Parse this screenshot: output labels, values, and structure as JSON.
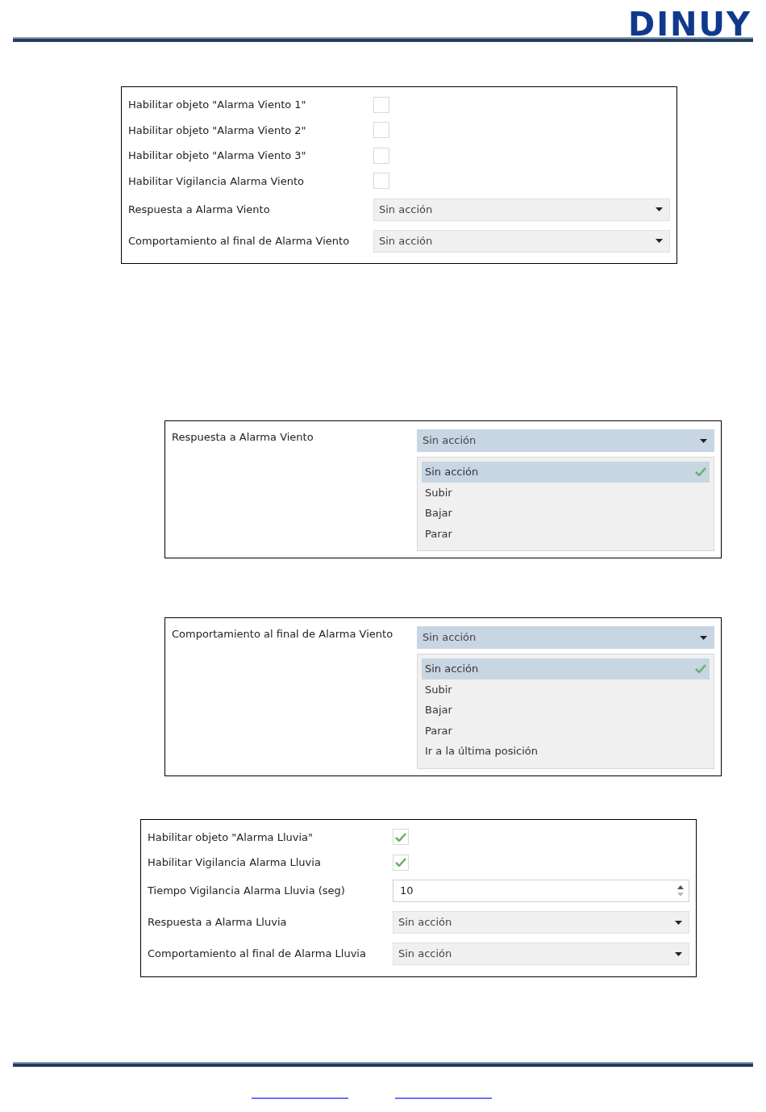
{
  "header": {
    "logo": "DINUY"
  },
  "panels": [
    {
      "kind": "form",
      "rows": [
        {
          "kind": "checkbox",
          "label": "Habilitar objeto \"Alarma Viento 1\"",
          "checked": false
        },
        {
          "kind": "checkbox",
          "label": "Habilitar objeto \"Alarma Viento 2\"",
          "checked": false
        },
        {
          "kind": "checkbox",
          "label": "Habilitar objeto \"Alarma Viento 3\"",
          "checked": false
        },
        {
          "kind": "checkbox",
          "label": "Habilitar Vigilancia Alarma Viento",
          "checked": false
        },
        {
          "kind": "select",
          "label": "Respuesta a Alarma Viento",
          "value": "Sin acción"
        },
        {
          "kind": "select",
          "label": "Comportamiento al final de Alarma Viento",
          "value": "Sin acción"
        }
      ]
    },
    {
      "kind": "dropdown",
      "rows": [
        {
          "kind": "select",
          "label": "Respuesta a Alarma Viento",
          "value": "Sin acción",
          "expanded": true,
          "options": [
            {
              "label": "Sin acción",
              "selected": true
            },
            {
              "label": "Subir",
              "selected": false
            },
            {
              "label": "Bajar",
              "selected": false
            },
            {
              "label": "Parar",
              "selected": false
            }
          ]
        }
      ]
    },
    {
      "kind": "dropdown",
      "rows": [
        {
          "kind": "select",
          "label": "Comportamiento al final de Alarma Viento",
          "value": "Sin acción",
          "expanded": true,
          "options": [
            {
              "label": "Sin acción",
              "selected": true
            },
            {
              "label": "Subir",
              "selected": false
            },
            {
              "label": "Bajar",
              "selected": false
            },
            {
              "label": "Parar",
              "selected": false
            },
            {
              "label": "Ir a la última posición",
              "selected": false
            }
          ]
        }
      ]
    },
    {
      "kind": "form",
      "rows": [
        {
          "kind": "checkbox",
          "label": "Habilitar objeto \"Alarma Lluvia\"",
          "checked": true
        },
        {
          "kind": "checkbox",
          "label": "Habilitar Vigilancia Alarma Lluvia",
          "checked": true
        },
        {
          "kind": "number",
          "label": "Tiempo Vigilancia Alarma Lluvia (seg)",
          "value": "10"
        },
        {
          "kind": "select",
          "label": "Respuesta a Alarma Lluvia",
          "value": "Sin acción"
        },
        {
          "kind": "select",
          "label": "Comportamiento al final de Alarma Lluvia",
          "value": "Sin acción"
        }
      ]
    }
  ],
  "footer": {
    "links": [
      {
        "kind": "blank-link"
      },
      {
        "kind": "blank-link"
      }
    ]
  }
}
